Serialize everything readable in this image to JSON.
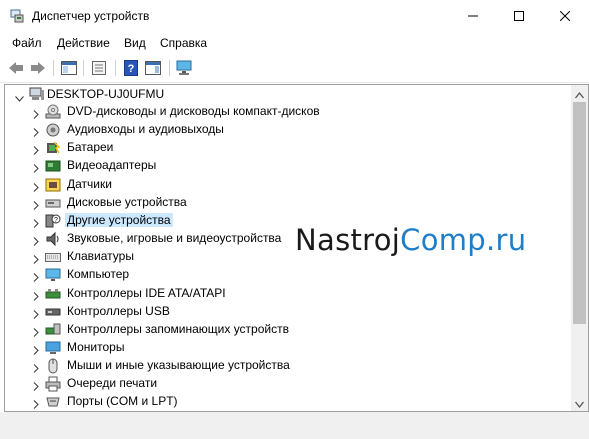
{
  "window": {
    "title": "Диспетчер устройств",
    "app_icon": "device-manager-icon"
  },
  "menu": {
    "items": [
      "Файл",
      "Действие",
      "Вид",
      "Справка"
    ]
  },
  "toolbar": {
    "buttons": [
      "back-arrow-icon",
      "forward-arrow-icon",
      "show-hide-console-tree-icon",
      "properties-icon",
      "help-icon",
      "action-pane-icon",
      "scan-hardware-icon"
    ]
  },
  "tree": {
    "root": "DESKTOP-UJ0UFMU",
    "items": [
      {
        "label": "DVD-дисководы и дисководы компакт-дисков",
        "icon": "dvd-drive-icon"
      },
      {
        "label": "Аудиовходы и аудиовыходы",
        "icon": "audio-io-icon"
      },
      {
        "label": "Батареи",
        "icon": "battery-icon"
      },
      {
        "label": "Видеоадаптеры",
        "icon": "display-adapter-icon"
      },
      {
        "label": "Датчики",
        "icon": "sensor-icon"
      },
      {
        "label": "Дисковые устройства",
        "icon": "disk-drive-icon"
      },
      {
        "label": "Другие устройства",
        "icon": "other-devices-icon",
        "selected": true
      },
      {
        "label": "Звуковые, игровые и видеоустройства",
        "icon": "sound-video-icon"
      },
      {
        "label": "Клавиатуры",
        "icon": "keyboard-icon"
      },
      {
        "label": "Компьютер",
        "icon": "computer-icon"
      },
      {
        "label": "Контроллеры IDE ATA/ATAPI",
        "icon": "ide-controller-icon"
      },
      {
        "label": "Контроллеры USB",
        "icon": "usb-controller-icon"
      },
      {
        "label": "Контроллеры запоминающих устройств",
        "icon": "storage-controller-icon"
      },
      {
        "label": "Мониторы",
        "icon": "monitor-icon"
      },
      {
        "label": "Мыши и иные указывающие устройства",
        "icon": "mouse-icon"
      },
      {
        "label": "Очереди печати",
        "icon": "print-queue-icon"
      },
      {
        "label": "Порты (COM и LPT)",
        "icon": "ports-icon"
      }
    ]
  },
  "watermark": {
    "part1": "Nastroj",
    "part2": "Comp.ru"
  }
}
